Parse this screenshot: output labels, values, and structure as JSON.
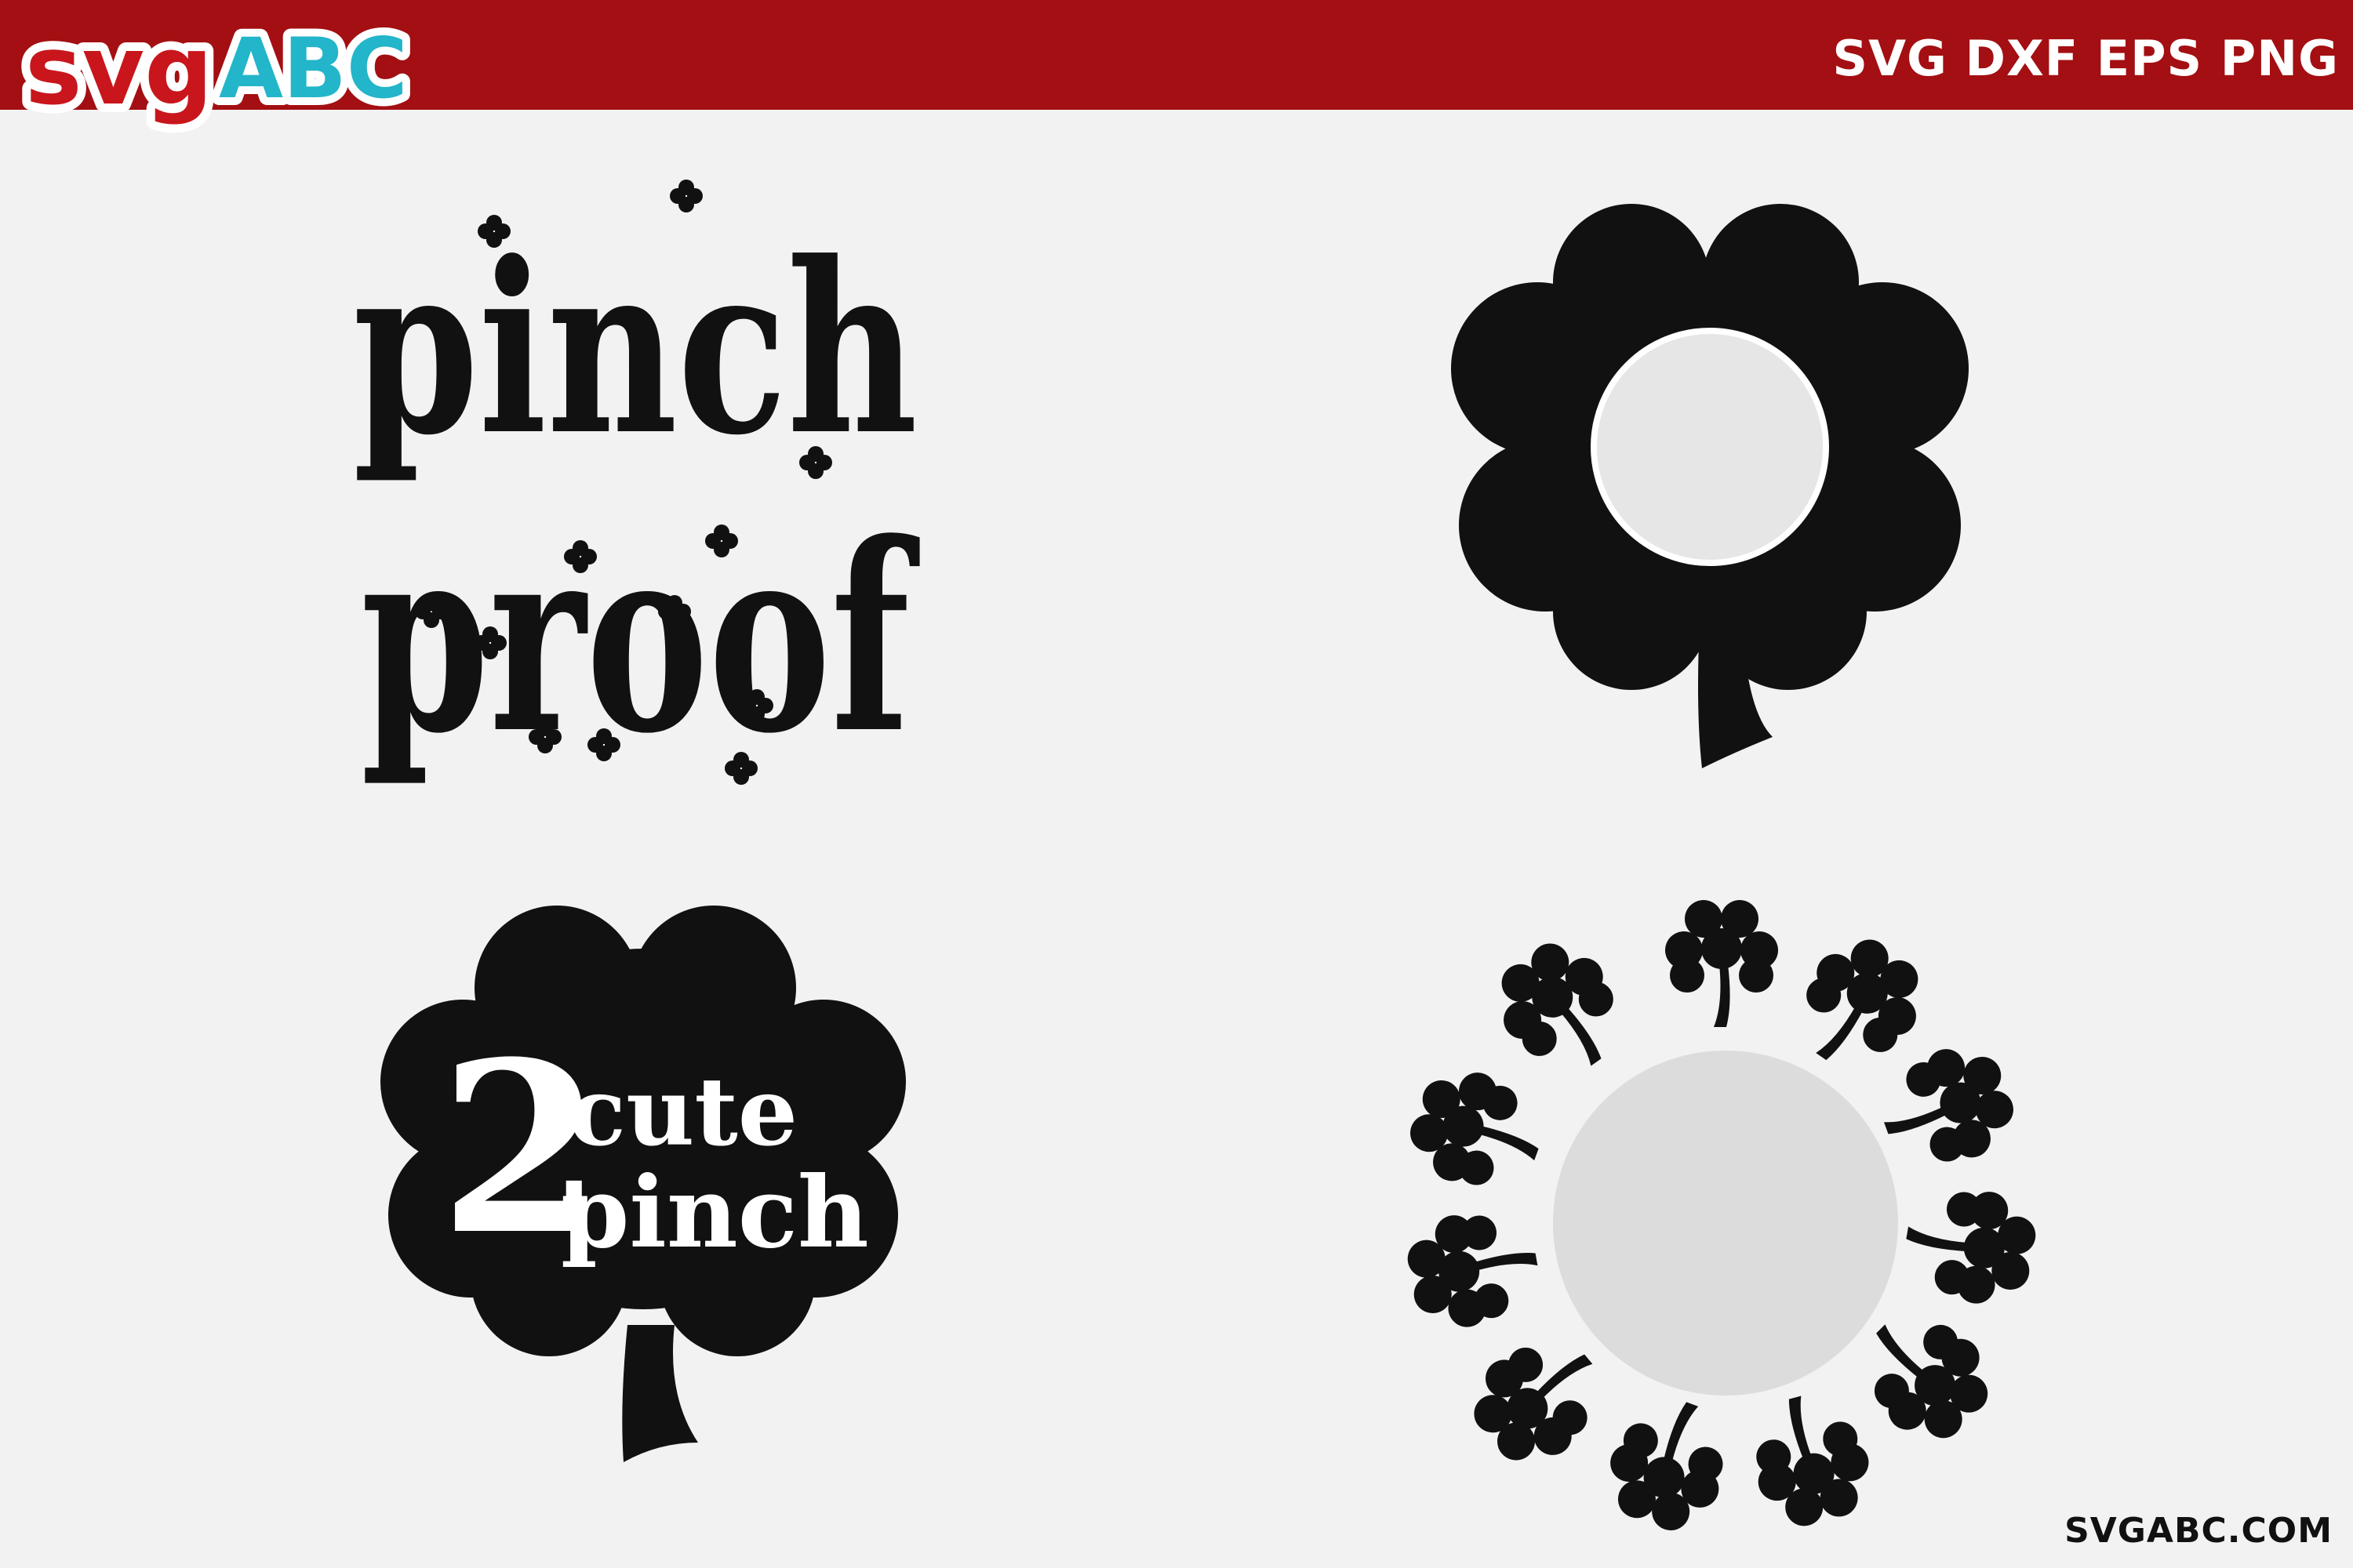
{
  "brand": {
    "logo_part1": "svg",
    "logo_part2": "ABC",
    "logo_color_main": "#c8161c",
    "logo_color_accent": "#23b5c9",
    "header_color": "#a30f12"
  },
  "header": {
    "formats": "SVG DXF EPS PNG"
  },
  "designs": {
    "pinch_proof": {
      "line1": "pinch",
      "line2": "proof",
      "icon": "shamrock-icon"
    },
    "clover_monogram": {
      "icon": "four-leaf-clover-icon"
    },
    "two_cute_to_pinch": {
      "numeral": "2",
      "word1": "cute",
      "word2": "pinch",
      "icon": "shamrock-icon"
    },
    "shamrock_wreath": {
      "icon": "shamrock-icon"
    }
  },
  "footer": {
    "url": "SVGABC.COM"
  }
}
